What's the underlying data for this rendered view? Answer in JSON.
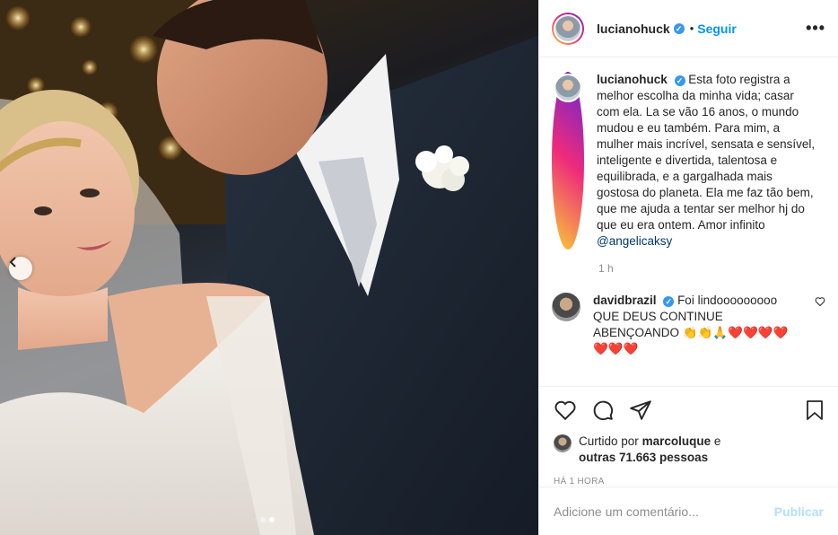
{
  "post": {
    "username": "lucianohuck",
    "verified": true,
    "follow_label": "Seguir",
    "separator": "•",
    "more_label": "•••"
  },
  "caption": {
    "username": "lucianohuck",
    "text": "Esta foto registra a melhor escolha da minha vida; casar com ela. La se vão 16 anos, o mundo mudou e eu também. Para mim, a mulher mais incrível, sensata e sensível, inteligente e divertida, talentosa e equilibrada, e a gargalhada mais gostosa do planeta. Ela me faz tão bem, que me ajuda a tentar ser melhor hj do que eu era ontem. Amor infinito",
    "mention": "@angelicaksy",
    "time": "1 h"
  },
  "comments": [
    {
      "username": "davidbrazil",
      "verified": true,
      "text": "Foi lindooooooooo QUE DEUS CONTINUE ABENÇOANDO 👏👏🙏❤️❤️❤️❤️❤️❤️❤️"
    }
  ],
  "likes": {
    "prefix": "Curtido por",
    "user": "marcoluque",
    "and": "e",
    "others": "outras 71.663 pessoas"
  },
  "timestamp": "Há 1 hora",
  "comment_box": {
    "placeholder": "Adicione um comentário...",
    "publish_label": "Publicar"
  },
  "carousel": {
    "total": 2,
    "active": 2
  },
  "colors": {
    "accent": "#0095f6",
    "publish_disabled": "#b2dffc",
    "mention": "#00376b",
    "secondary_text": "#8e8e8e",
    "border": "#efefef"
  },
  "icons": [
    "chevron-left-icon",
    "verified-icon",
    "more-icon",
    "heart-icon",
    "comment-icon",
    "share-icon",
    "bookmark-icon"
  ]
}
